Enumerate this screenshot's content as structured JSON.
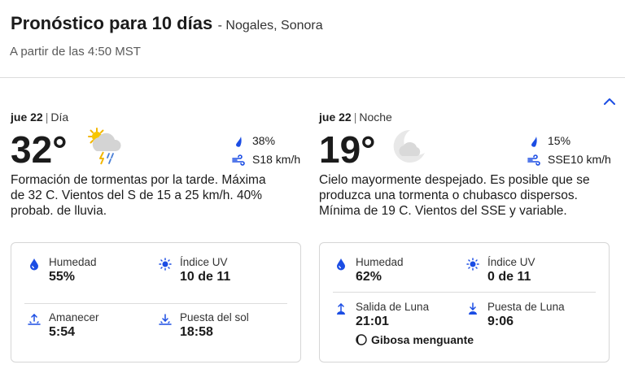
{
  "header": {
    "title": "Pronóstico para 10 días",
    "location": "- Nogales, Sonora",
    "updated": "A partir de las 4:50 MST"
  },
  "day": {
    "date": "jue 22",
    "period": "Día",
    "temperature": "32°",
    "condition_icon": "thunderstorm-partly-sunny-icon",
    "precip": "38%",
    "wind": "S18 km/h",
    "narrative": "Formación de tormentas por la tarde. Máxima de 32 C. Vientos del S de 15 a 25 km/h. 40% probab. de lluvia.",
    "details": {
      "humidity_label": "Humedad",
      "humidity": "55%",
      "uv_label": "Índice UV",
      "uv": "10 de 11",
      "sunrise_label": "Amanecer",
      "sunrise": "5:54",
      "sunset_label": "Puesta del sol",
      "sunset": "18:58"
    }
  },
  "night": {
    "date": "jue 22",
    "period": "Noche",
    "temperature": "19°",
    "condition_icon": "partly-cloudy-night-icon",
    "precip": "15%",
    "wind": "SSE10 km/h",
    "narrative": "Cielo mayormente despejado. Es posible que se produzca una tormenta o chubasco dispersos. Mínima de 19 C. Vientos del SSE y variable.",
    "details": {
      "humidity_label": "Humedad",
      "humidity": "62%",
      "uv_label": "Índice UV",
      "uv": "0 de 11",
      "moonrise_label": "Salida de Luna",
      "moonrise": "21:01",
      "moonset_label": "Puesta de Luna",
      "moonset": "9:06",
      "moon_phase": "Gibosa menguante"
    }
  },
  "colors": {
    "accent": "#1b4de4",
    "text": "#1b1b1b",
    "muted": "#5a5a5a",
    "border": "#d6d6d6"
  }
}
